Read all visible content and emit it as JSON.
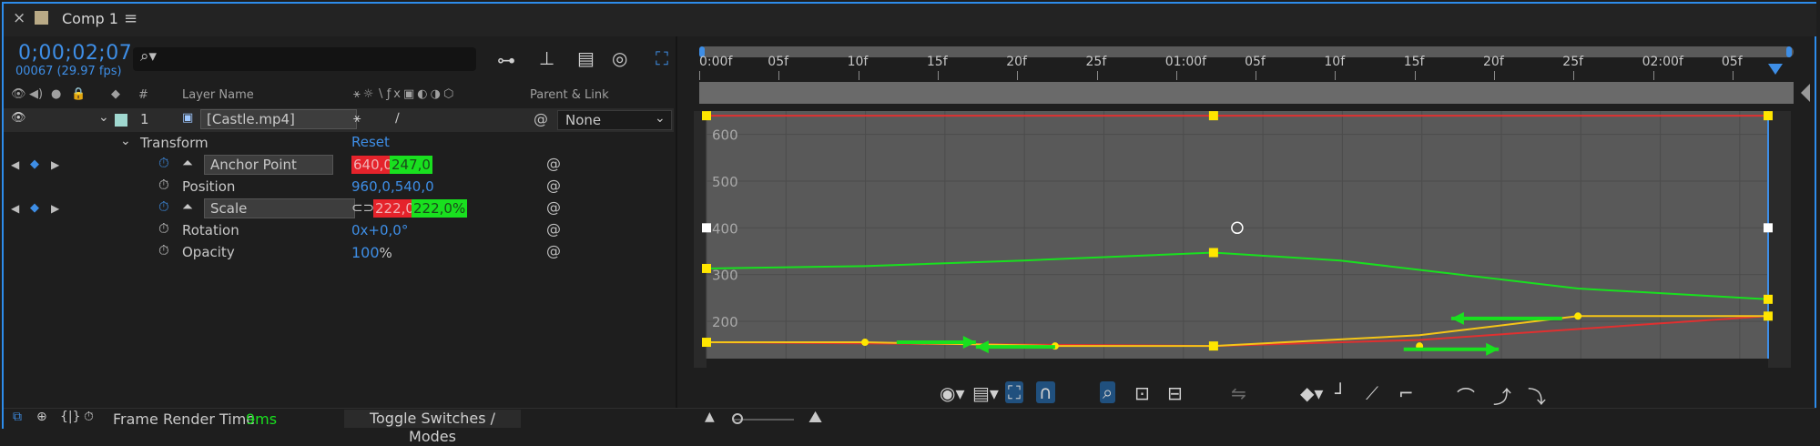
{
  "tab": {
    "close": "×",
    "title": "Comp 1",
    "menu": "≡"
  },
  "time": {
    "timecode": "0;00;02;07",
    "frames_fps": "00067 (29.97 fps)"
  },
  "search": {
    "icon": "magnifier-icon",
    "value": ""
  },
  "columns": {
    "layer_num": "#",
    "layer_name": "Layer Name",
    "parent_link": "Parent & Link"
  },
  "layer": {
    "number": "1",
    "name": "[Castle.mp4]",
    "parent": "None"
  },
  "transform": {
    "label": "Transform",
    "reset": "Reset"
  },
  "properties": [
    {
      "name": "Anchor Point",
      "value_x": "640,0",
      "value_y": "247,0",
      "keyframed": true
    },
    {
      "name": "Position",
      "value": "960,0,540,0",
      "keyframed": false
    },
    {
      "name": "Scale",
      "value_x": "222,0,",
      "value_y": "222,0%",
      "keyframed": true
    },
    {
      "name": "Rotation",
      "value": "0x+0,0°",
      "keyframed": false
    },
    {
      "name": "Opacity",
      "value_num": "100",
      "value_unit": "%",
      "keyframed": false
    }
  ],
  "status": {
    "frame_render_label": "Frame Render Time",
    "frame_render_value": "9ms",
    "toggle": "Toggle Switches / Modes"
  },
  "ruler": [
    "0:00f",
    "05f",
    "10f",
    "15f",
    "20f",
    "25f",
    "01:00f",
    "05f",
    "10f",
    "15f",
    "20f",
    "25f",
    "02:00f",
    "05f"
  ],
  "colors": {
    "accent": "#2d8ceb",
    "red_curve": "#e03030",
    "green_curve": "#19e01f",
    "yellow_curve": "#f5c518",
    "keyframe": "#ffe600"
  },
  "chart_data": {
    "type": "line",
    "ylabels": [
      "600",
      "500",
      "400",
      "300",
      "200"
    ],
    "yticks": [
      600,
      500,
      400,
      300,
      200
    ],
    "ylim": [
      120,
      650
    ],
    "xlim": [
      0,
      67
    ],
    "series": [
      {
        "values_x": [
          0,
          32,
          67
        ],
        "values_y": [
          640,
          640,
          640
        ]
      },
      {
        "values_x": [
          0,
          10,
          20,
          32,
          40,
          55,
          67
        ],
        "values_y": [
          313,
          318,
          330,
          347,
          330,
          270,
          247
        ]
      },
      {
        "values_x": [
          0,
          32,
          45,
          60,
          67
        ],
        "values_y": [
          155,
          147,
          160,
          195,
          211
        ]
      },
      {
        "values_x": [
          0,
          10,
          22,
          32,
          45,
          55,
          67
        ],
        "values_y": [
          155,
          155,
          147,
          147,
          170,
          211,
          211
        ]
      }
    ],
    "keyframes_x": [
      0,
      32,
      67
    ]
  }
}
